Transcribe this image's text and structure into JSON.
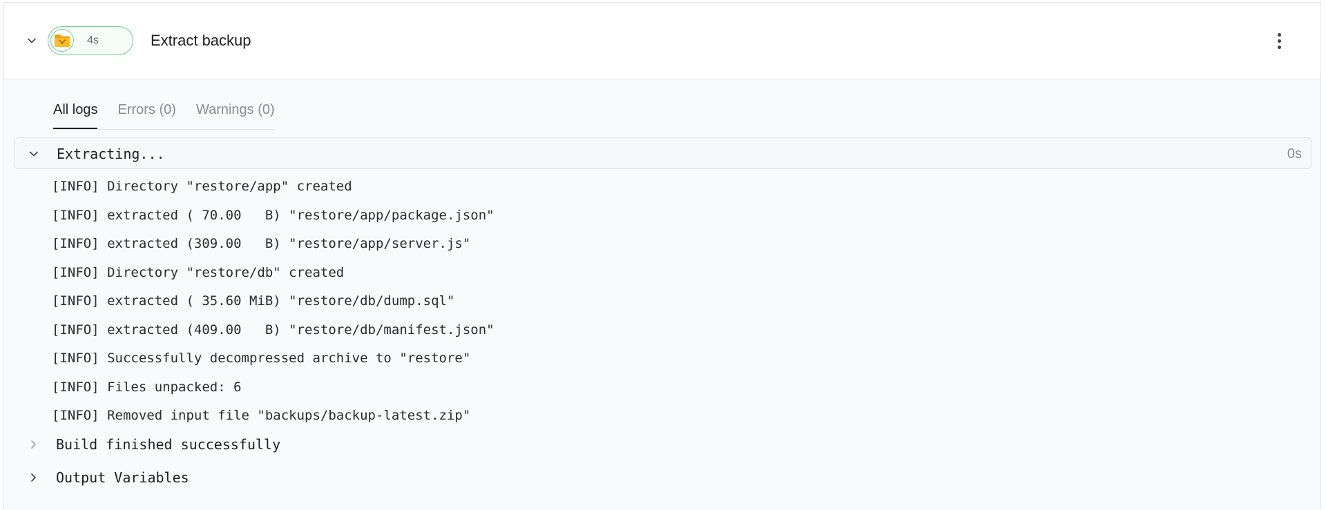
{
  "step": {
    "title": "Extract backup",
    "duration": "4s",
    "status_color": "#6fcf8f"
  },
  "tabs": [
    {
      "label": "All logs",
      "active": true
    },
    {
      "label": "Errors (0)",
      "active": false
    },
    {
      "label": "Warnings (0)",
      "active": false
    }
  ],
  "group": {
    "name": "Extracting...",
    "time": "0s",
    "lines": [
      "[INFO] Directory \"restore/app\" created",
      "[INFO] extracted ( 70.00   B) \"restore/app/package.json\"",
      "[INFO] extracted (309.00   B) \"restore/app/server.js\"",
      "[INFO] Directory \"restore/db\" created",
      "[INFO] extracted ( 35.60 MiB) \"restore/db/dump.sql\"",
      "[INFO] extracted (409.00   B) \"restore/db/manifest.json\"",
      "[INFO] Successfully decompressed archive to \"restore\"",
      "[INFO] Files unpacked: 6",
      "[INFO] Removed input file \"backups/backup-latest.zip\""
    ]
  },
  "collapsed_groups": [
    {
      "name": "Build finished successfully"
    },
    {
      "name": "Output Variables"
    }
  ]
}
